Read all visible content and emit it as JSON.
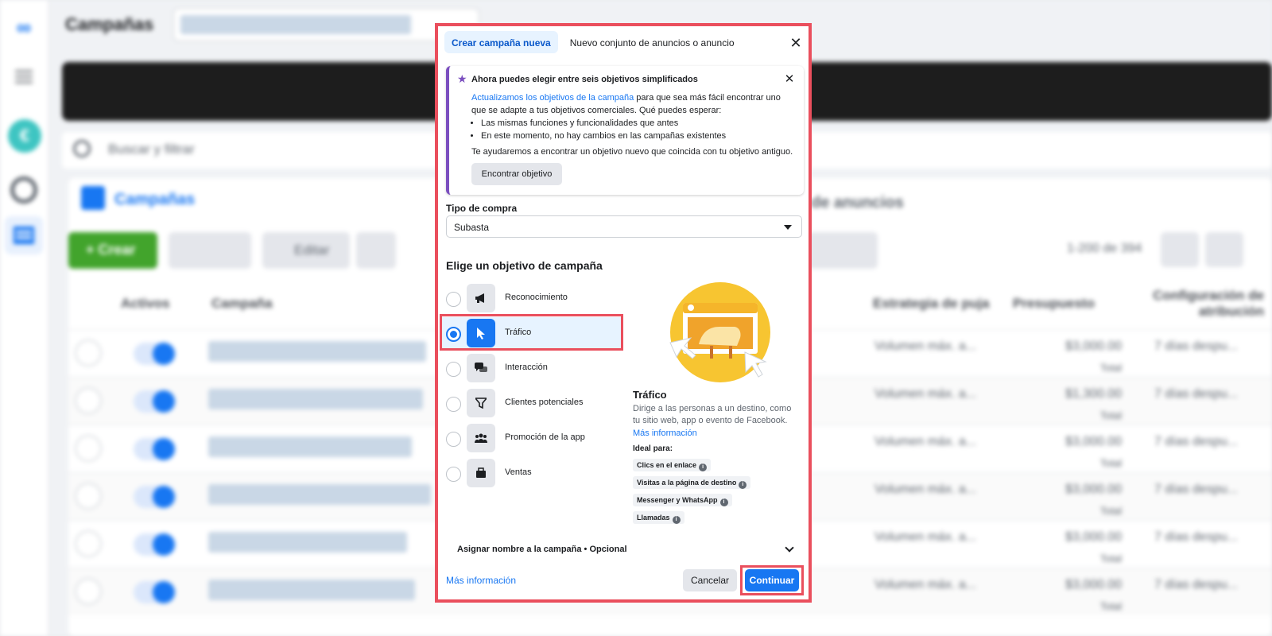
{
  "background": {
    "page_title": "Campañas",
    "search_placeholder": "Buscar y filtrar",
    "tab_campaigns": "Campañas",
    "tab_ads": "de anuncios",
    "create_label": "+ Crear",
    "edit_label": "Editar",
    "range_label": "1-200 de 394",
    "columns": [
      "Activos",
      "Campaña",
      "Estrategia de puja",
      "Presupuesto",
      "Configuración de atribución"
    ],
    "rows": [
      {
        "bid": "Volumen máx. a...",
        "budget": "$3,000.00",
        "period": "Total",
        "attribution": "7 días despu..."
      },
      {
        "bid": "Volumen máx. a...",
        "budget": "$1,300.00",
        "period": "Total",
        "attribution": "7 días despu..."
      },
      {
        "bid": "Volumen máx. a...",
        "budget": "$3,000.00",
        "period": "Total",
        "attribution": "7 días despu..."
      },
      {
        "bid": "Volumen máx. a...",
        "budget": "$3,000.00",
        "period": "Total",
        "attribution": "7 días despu..."
      },
      {
        "bid": "Volumen máx. a...",
        "budget": "$3,000.00",
        "period": "Total",
        "attribution": "7 días despu..."
      },
      {
        "bid": "Volumen máx. a...",
        "budget": "$3,000.00",
        "period": "Total",
        "attribution": "7 días despu..."
      }
    ]
  },
  "modal": {
    "tabs": [
      "Crear campaña nueva",
      "Nuevo conjunto de anuncios o anuncio"
    ],
    "notice": {
      "title": "Ahora puedes elegir entre seis objetivos simplificados",
      "link": "Actualizamos los objetivos de la campaña",
      "body": " para que sea más fácil encontrar uno que se adapte a tus objetivos comerciales. Qué puedes esperar:",
      "bullets": [
        "Las mismas funciones y funcionalidades que antes",
        "En este momento, no hay cambios en las campañas existentes"
      ],
      "extra": "Te ayudaremos a encontrar un objetivo nuevo que coincida con tu objetivo antiguo.",
      "button": "Encontrar objetivo"
    },
    "purchase_type_label": "Tipo de compra",
    "purchase_type_value": "Subasta",
    "objective_heading": "Elige un objetivo de campaña",
    "objectives": [
      {
        "label": "Reconocimiento",
        "icon": "megaphone-icon",
        "selected": false
      },
      {
        "label": "Tráfico",
        "icon": "cursor-icon",
        "selected": true
      },
      {
        "label": "Interacción",
        "icon": "chat-bubbles-icon",
        "selected": false
      },
      {
        "label": "Clientes potenciales",
        "icon": "funnel-icon",
        "selected": false
      },
      {
        "label": "Promoción de la app",
        "icon": "people-icon",
        "selected": false
      },
      {
        "label": "Ventas",
        "icon": "briefcase-icon",
        "selected": false
      }
    ],
    "detail": {
      "title": "Tráfico",
      "description": "Dirige a las personas a un destino, como tu sitio web, app o evento de Facebook.",
      "more_link": "Más información",
      "ideal_label": "Ideal para:",
      "chips": [
        "Clics en el enlace",
        "Visitas a la página de destino",
        "Messenger y WhatsApp",
        "Llamadas"
      ]
    },
    "name_row": "Asignar nombre a la campaña • Opcional",
    "footer_link": "Más información",
    "cancel_label": "Cancelar",
    "continue_label": "Continuar"
  },
  "colors": {
    "accent": "#1877f2",
    "highlight_frame": "#ea4f5d",
    "notice_accent": "#7b4fbf",
    "illustration_yellow": "#f7c531"
  }
}
